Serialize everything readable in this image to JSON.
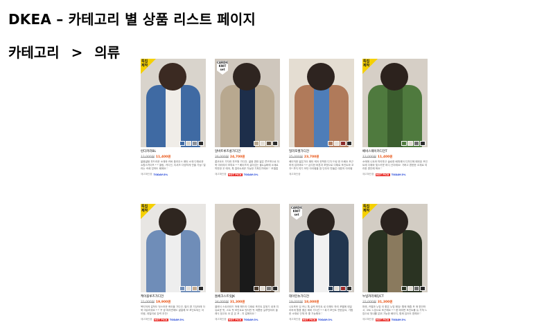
{
  "page": {
    "title": "DKEA – 카테고리 별 상품 리스트 페이지",
    "breadcrumb": {
      "parent": "카테고리",
      "separator": ">",
      "current": "의류"
    }
  },
  "badges": {
    "special": "특집\n제작",
    "knit": "CARDIGAN\nKNIT\nset"
  },
  "products": [
    {
      "name": "린다카라BL",
      "old_price": "12,000원",
      "new_price": "11,400원",
      "desc": "얇음얇음 부드러운 소재와 커버 옵라우스 패턴 소재 다채로운 쇼핑스카이프 * * 클링, 카디건, 티셔츠 다양하게 연출 가능! 컬러는 속에 업하도 페에요♡",
      "tag_delivery": "재고확인중",
      "tag_red": "",
      "tag_today": "TODAY:3%",
      "badge": "special",
      "bg": "#d9d4cc",
      "skin": "#3b2a22",
      "coat": "#3f6aa3",
      "inner": "#f0ede8",
      "swatches": [
        "#3f6aa3",
        "#d8d2c8",
        "#8a8f99",
        "#2a2a2a"
      ]
    },
    {
      "name": "알바트루즈롱가디건",
      "old_price": "26,000원",
      "new_price": "24,700원",
      "desc": "롱코트도 가지런 부츠형 가디건- 얇음 편한 얇은 루즈핏으로 더욱 여리여리 보여요 * * 베이즈의 살아있는 울&실화에 소재로 따뜻한 곳 에어, 톡 칼라&새큰 가능한 기획단가에요♡ 모델컬은 맛 색 입어보세요♡",
      "tag_delivery": "재고확인중",
      "tag_red": "HOT PICK",
      "tag_today": "TODAY:3%",
      "badge": "knit",
      "bg": "#cfc7bd",
      "skin": "#2f2520",
      "coat": "#b8a88f",
      "inner": "#1d2e4a",
      "swatches": [
        "#b8a88f",
        "#e2ddd4",
        "#5b4e40",
        "#2a2a2a"
      ]
    },
    {
      "name": "밀러포켓가디건",
      "old_price": "25,000원",
      "new_price": "23,700원",
      "desc": "베이직한 얇은가이 패턴 케어 컨백한 디자 드링 한 도베요 포근하게 입어봐요 *.* 급식한 버튼과 포켓으로 다채로 포인트와 코지* 까지 여기 모던 아이템을 참 단무이 만들은 대표의 아이템으로 추천해요♡",
      "tag_delivery": "재고확인중",
      "tag_red": "",
      "tag_today": "",
      "badge": "",
      "bg": "#e4ddd2",
      "skin": "#2e2420",
      "coat": "#b07a5a",
      "inner": "#4e7db8",
      "swatches": [
        "#b07a5a",
        "#e6e0d6",
        "#8a2a2a",
        "#2a2a2a"
      ]
    },
    {
      "name": "베비스웨이카디건T",
      "old_price": "12,000원",
      "new_price": "11,400원",
      "desc": "소매에 니트와 따라뜻고 솔로한 배피래어 디자인에 패턴된 포인트에 다채와 빛스카운 퍼디 간이에요! 가벼고 편한한 소재로 여리한 편안해 봐요♡",
      "tag_delivery": "재고확인중",
      "tag_red": "HOT PICK",
      "tag_today": "TODAY:3%",
      "badge": "special",
      "bg": "#d6cfc6",
      "skin": "#2c221d",
      "coat": "#4f7a3e",
      "inner": "#3b5e2e",
      "swatches": [
        "#4f7a3e",
        "#e0dad0",
        "#6b6b6b",
        "#2a2a2a"
      ]
    },
    {
      "name": "케이블루즈가디건",
      "old_price": "21,000원",
      "new_price": "19,900원",
      "desc": "목티하게 걸쳐도 멋스러운 케이블 가디건. 멀리 편 기당아래 더욱 여유러워요 * * 꾸 광 피라면에도 쌀쌀해 보 포인트되는 아이템, 데일리로 강력 추천!",
      "tag_delivery": "재고확인중",
      "tag_red": "HOT PICK",
      "tag_today": "TODAY:3%",
      "badge": "special",
      "bg": "#e8e6e3",
      "skin": "#2f2620",
      "coat": "#6f8db8",
      "inner": "#eeeeee",
      "swatches": [
        "#6f8db8",
        "#e4e0da",
        "#c4aa90",
        "#2a2a2a"
      ]
    },
    {
      "name": "톰베크스트릿JK",
      "old_price": "34,000원",
      "new_price": "31,300원",
      "desc": "클래식 스트라이드 쳐에 헤드라 디테로 포인트 분위기 내게 여유로운 핏, 스트 핏 포인트로 멋지만 핏 여름한 실루엣이라 클래식 잠고트 요 분 온 포 - 지 걸에어요♡",
      "tag_delivery": "재고확인중",
      "tag_red": "HOT PICK",
      "tag_today": "TODAY:3%",
      "badge": "",
      "bg": "#d9d2c8",
      "skin": "#2b221d",
      "coat": "#4a3a2c",
      "inner": "#1a1a1a",
      "swatches": [
        "#4a3a2c",
        "#e2dcd2",
        "#7a7a7a",
        "#2a2a2a"
      ]
    },
    {
      "name": "데이틴뉴가디건",
      "old_price": "19,000원",
      "new_price": "18,000원",
      "desc": "니트포탄 임 커니 톡 실력 포인트 로 이해도 하리 포뗼에 데일리하게 활용 좋은 해버 가디건 * * 룩가 포인트 연한분요, 가볍 한 소재로 단체 하 좋 가능해요♡",
      "tag_delivery": "재고확인중",
      "tag_red": "HOT PICK",
      "tag_today": "TODAY:3%",
      "badge": "knit",
      "bg": "#cfcac4",
      "skin": "#2b2420",
      "coat": "#22364f",
      "inner": "#f1f1f1",
      "swatches": [
        "#22364f",
        "#e3ddd4",
        "#9e2d2d",
        "#2a2a2a"
      ]
    },
    {
      "name": "누빔카라패딩CT",
      "old_price": "32,000원",
      "new_price": "31,300원",
      "desc": "퍼켓, 카멜과 누빔 이 좋은 누빔 패딩! 활에 해줍 포 매 편안하고, 코트 느낌으로 포근해요 * * 편 에어면 포인트를 듀 가적 느낌으로 멋내를 분위 가능한 배이지, 함께 입어도 편해요♡",
      "tag_delivery": "재고확인중",
      "tag_red": "HOT PICK",
      "tag_today": "TODAY:3%",
      "badge": "special",
      "bg": "#d3cdc4",
      "skin": "#2a221e",
      "coat": "#2a3322",
      "inner": "#8a7a5e",
      "swatches": [
        "#2a3322",
        "#e2dcd2",
        "#6a6a6a",
        "#2a2a2a"
      ]
    }
  ],
  "colors": {
    "price_accent": "#e8500f",
    "hot_red": "#e8231e",
    "today_blue": "#1b3fd6",
    "badge_yellow": "#f5d000"
  }
}
